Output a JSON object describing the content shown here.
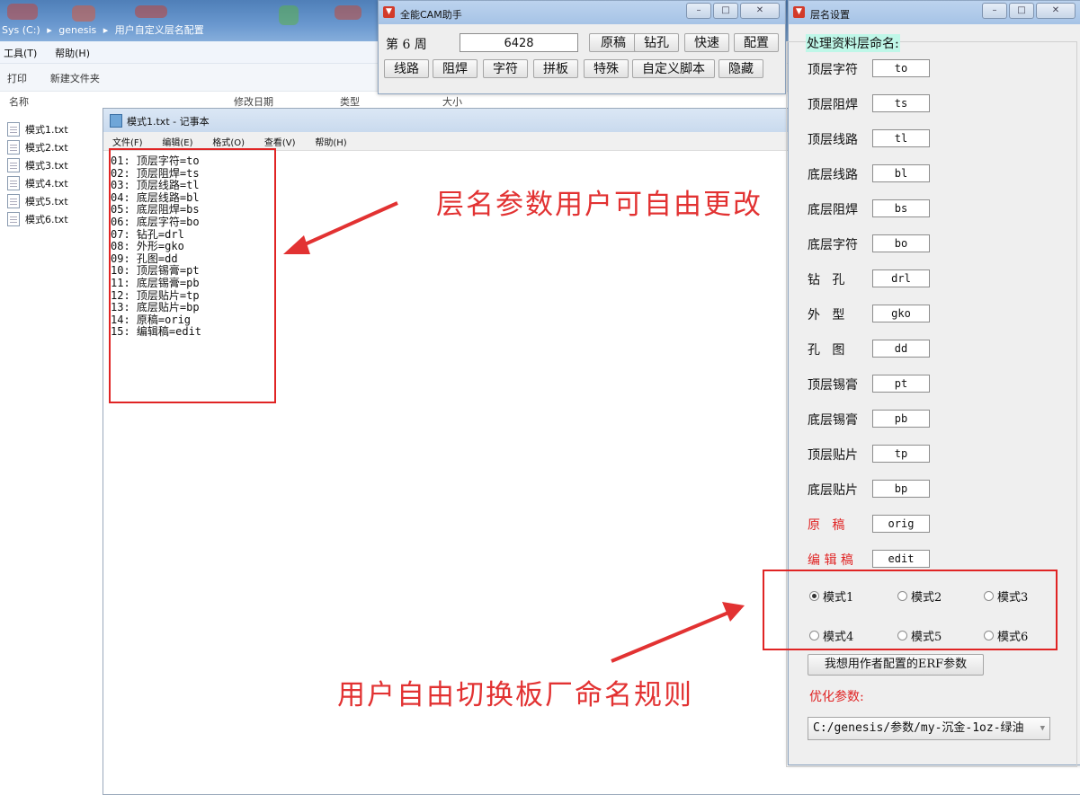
{
  "explorer": {
    "breadcrumb": [
      "Sys (C:)",
      "▸",
      "genesis",
      "▸",
      "用户自定义层名配置"
    ],
    "menu": [
      "工具(T)",
      "帮助(H)"
    ],
    "toolbar": [
      "打印",
      "新建文件夹"
    ],
    "columns": [
      "名称",
      "修改日期",
      "类型",
      "大小"
    ],
    "files": [
      "模式1.txt",
      "模式2.txt",
      "模式3.txt",
      "模式4.txt",
      "模式5.txt",
      "模式6.txt"
    ]
  },
  "notepad": {
    "title": "模式1.txt - 记事本",
    "menu": [
      "文件(F)",
      "编辑(E)",
      "格式(O)",
      "查看(V)",
      "帮助(H)"
    ],
    "lines": [
      "01: 顶层字符=to",
      "02: 顶层阻焊=ts",
      "03: 顶层线路=tl",
      "04: 底层线路=bl",
      "05: 底层阻焊=bs",
      "06: 底层字符=bo",
      "07: 钻孔=drl",
      "08: 外形=gko",
      "09: 孔图=dd",
      "10: 顶层锡膏=pt",
      "11: 底层锡膏=pb",
      "12: 顶层贴片=tp",
      "13: 底层贴片=bp",
      "14: 原稿=orig",
      "15: 编辑稿=edit"
    ]
  },
  "annotations": {
    "top": "层名参数用户可自由更改",
    "bottom": "用户自由切换板厂命名规则",
    "color": "#e23232"
  },
  "cam_window": {
    "title": "全能CAM助手",
    "week_label": "第 6 周",
    "week_value": "6428",
    "row1_buttons": [
      "原稿",
      "钻孔",
      "快速",
      "配置"
    ],
    "row2_buttons": [
      "线路",
      "阻焊",
      "字符",
      "拼板",
      "特殊",
      "自定义脚本",
      "隐藏"
    ]
  },
  "layer_window": {
    "title": "层名设置",
    "group_title": "处理资料层命名:",
    "rows": [
      {
        "label": "顶层字符",
        "value": "to"
      },
      {
        "label": "顶层阻焊",
        "value": "ts"
      },
      {
        "label": "顶层线路",
        "value": "tl"
      },
      {
        "label": "底层线路",
        "value": "bl"
      },
      {
        "label": "底层阻焊",
        "value": "bs"
      },
      {
        "label": "底层字符",
        "value": "bo"
      },
      {
        "label": "钻   孔",
        "value": "drl"
      },
      {
        "label": "外   型",
        "value": "gko"
      },
      {
        "label": "孔   图",
        "value": "dd"
      },
      {
        "label": "顶层锡膏",
        "value": "pt"
      },
      {
        "label": "底层锡膏",
        "value": "pb"
      },
      {
        "label": "顶层贴片",
        "value": "tp"
      },
      {
        "label": "底层贴片",
        "value": "bp"
      },
      {
        "label": "原   稿",
        "value": "orig",
        "red": true
      },
      {
        "label": "编 辑 稿",
        "value": "edit",
        "red": true
      }
    ],
    "modes": [
      "模式1",
      "模式2",
      "模式3",
      "模式4",
      "模式5",
      "模式6"
    ],
    "selected_mode": "模式1",
    "erf_button": "我想用作者配置的ERF参数",
    "opt_label": "优化参数:",
    "opt_value": "C:/genesis/参数/my-沉金-1oz-绿油"
  }
}
